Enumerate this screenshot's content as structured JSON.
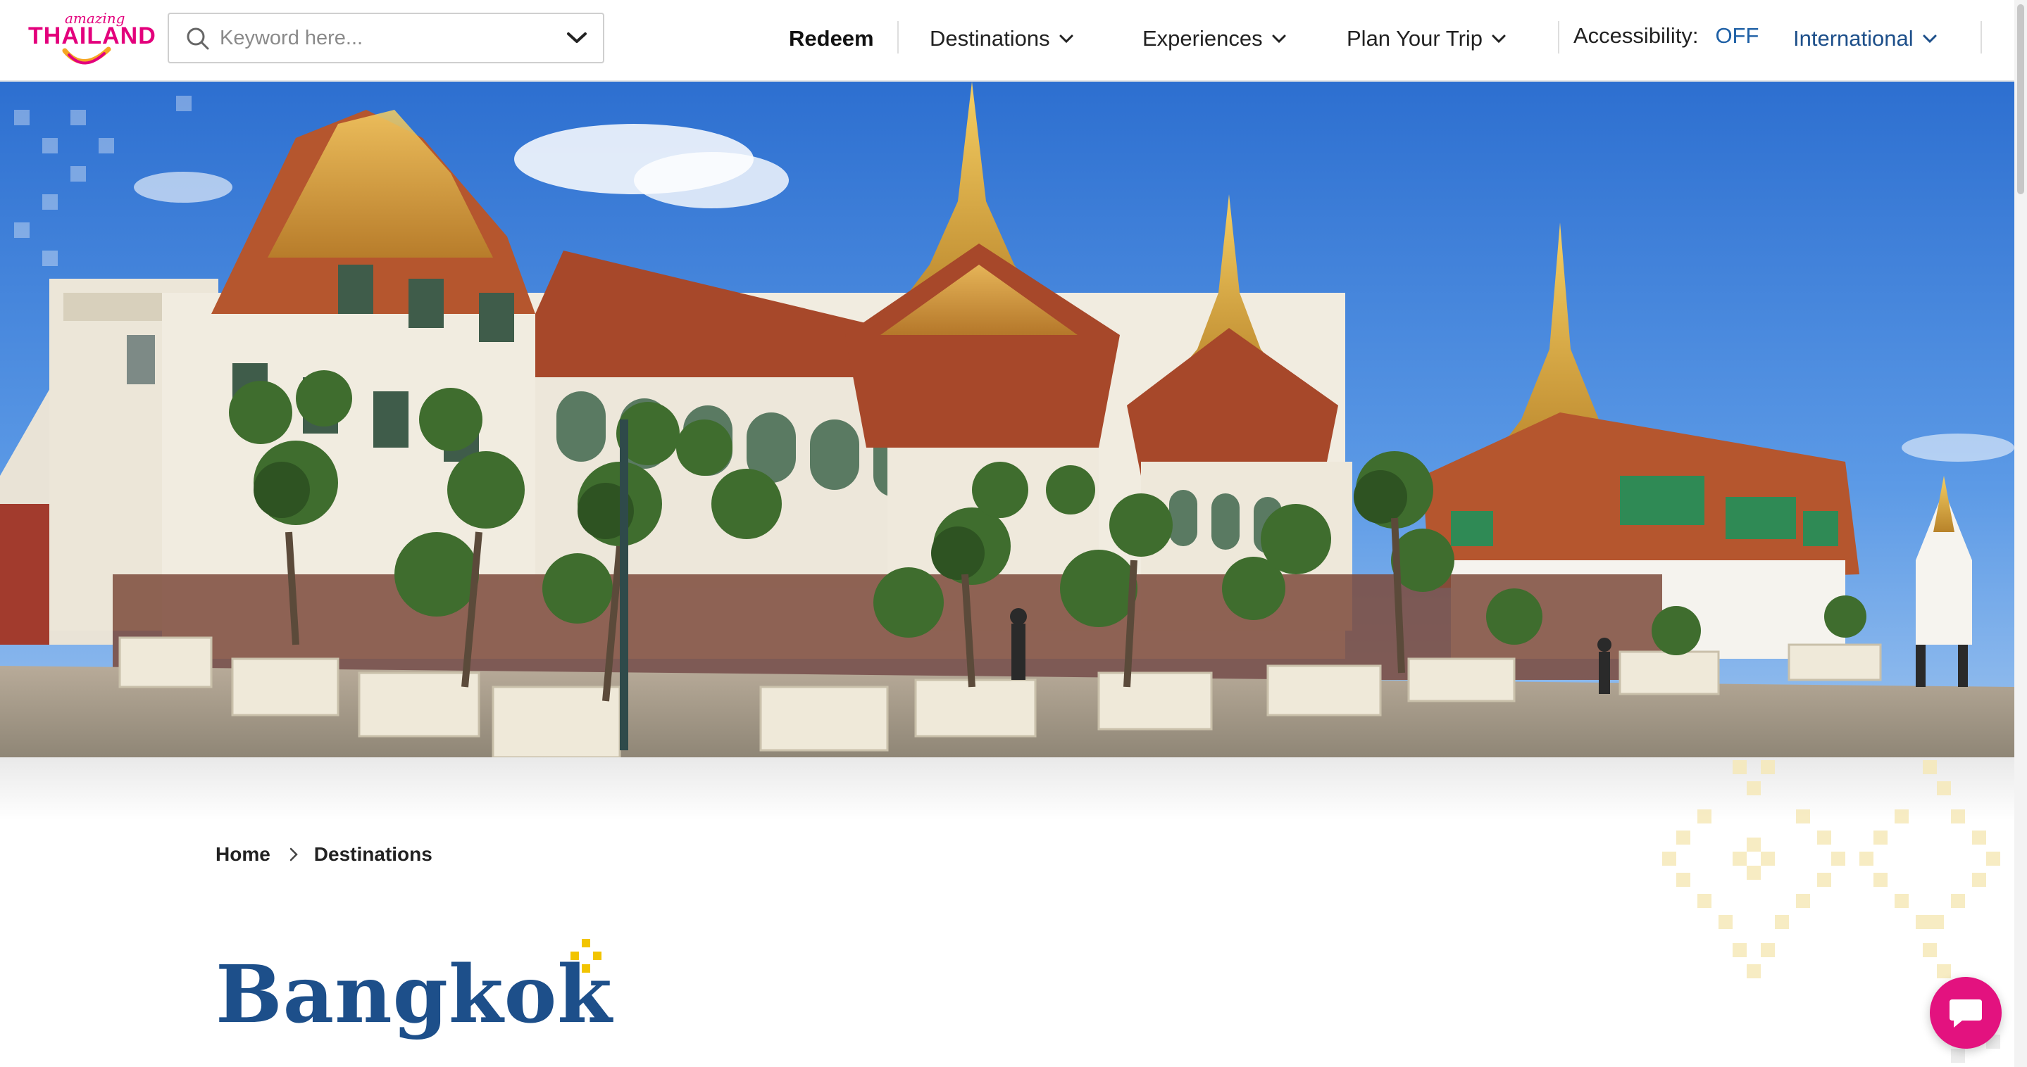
{
  "brand": {
    "logo_small": "amazing",
    "logo_big": "THAILAND",
    "accent": "#e3007c",
    "navy": "#1d4f8a",
    "link_blue": "#1d5fa5"
  },
  "search": {
    "placeholder": "Keyword here..."
  },
  "nav": {
    "redeem": "Redeem",
    "destinations": "Destinations",
    "experiences": "Experiences",
    "plan": "Plan Your Trip",
    "accessibility_label": "Accessibility:",
    "accessibility_value": "OFF",
    "international": "International"
  },
  "hero": {
    "image": "Grand Palace, Bangkok"
  },
  "breadcrumb": {
    "home": "Home",
    "current": "Destinations"
  },
  "page": {
    "title": "Bangkok"
  },
  "icons": [
    "search-icon",
    "chevron-down-icon",
    "chat-icon",
    "sparkle-icon",
    "chevron-right-icon"
  ]
}
